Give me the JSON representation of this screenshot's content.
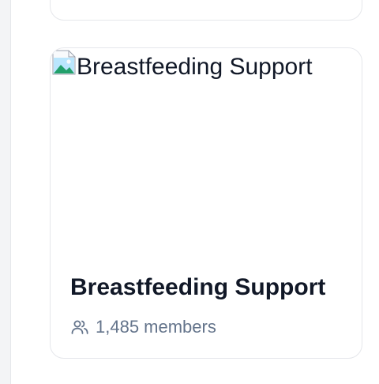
{
  "group_card": {
    "image_alt": "Breastfeeding Support",
    "title": "Breastfeeding Support",
    "member_count": "1,485 members",
    "icons": {
      "cover": "broken-image-icon",
      "members": "users-icon"
    }
  },
  "colors": {
    "title": "#111827",
    "muted": "#64748b",
    "card_border": "#e5e7eb"
  }
}
